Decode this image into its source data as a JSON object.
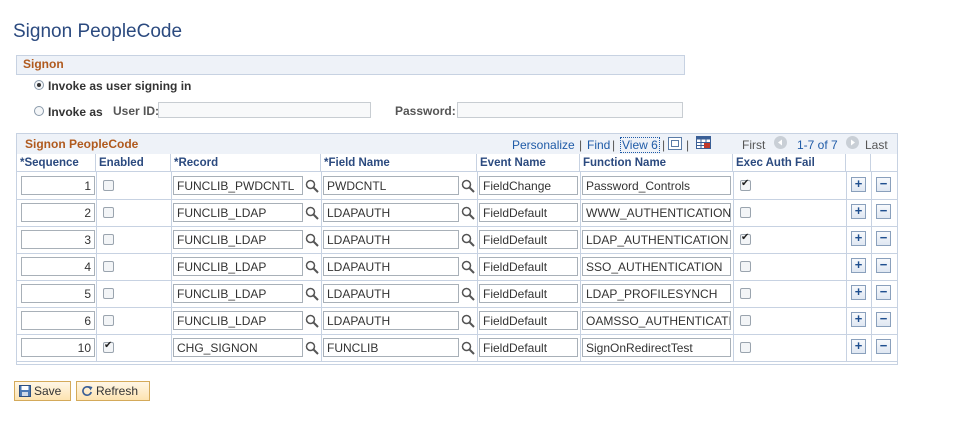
{
  "page_title": "Signon PeopleCode",
  "signon": {
    "section_title": "Signon",
    "option_invoke_signing_in": "Invoke as user signing in",
    "option_invoke_as": "Invoke as",
    "user_id_label": "User ID:",
    "user_id_value": "",
    "password_label": "Password:",
    "password_value": ""
  },
  "grid": {
    "title": "Signon PeopleCode",
    "personalize": "Personalize",
    "find": "Find",
    "view": "View 6",
    "sep": "|",
    "first": "First",
    "range": "1-7 of 7",
    "last": "Last",
    "columns": [
      "*Sequence",
      "Enabled",
      "*Record",
      "*Field Name",
      "Event Name",
      "Function Name",
      "Exec Auth Fail"
    ],
    "rows": [
      {
        "sequence": "1",
        "enabled": false,
        "record": "FUNCLIB_PWDCNTL",
        "field": "PWDCNTL",
        "event": "FieldChange",
        "function": "Password_Controls",
        "exec_auth_fail": true
      },
      {
        "sequence": "2",
        "enabled": false,
        "record": "FUNCLIB_LDAP",
        "field": "LDAPAUTH",
        "event": "FieldDefault",
        "function": "WWW_AUTHENTICATION",
        "exec_auth_fail": false
      },
      {
        "sequence": "3",
        "enabled": false,
        "record": "FUNCLIB_LDAP",
        "field": "LDAPAUTH",
        "event": "FieldDefault",
        "function": "LDAP_AUTHENTICATION",
        "exec_auth_fail": true
      },
      {
        "sequence": "4",
        "enabled": false,
        "record": "FUNCLIB_LDAP",
        "field": "LDAPAUTH",
        "event": "FieldDefault",
        "function": "SSO_AUTHENTICATION",
        "exec_auth_fail": false
      },
      {
        "sequence": "5",
        "enabled": false,
        "record": "FUNCLIB_LDAP",
        "field": "LDAPAUTH",
        "event": "FieldDefault",
        "function": "LDAP_PROFILESYNCH",
        "exec_auth_fail": false
      },
      {
        "sequence": "6",
        "enabled": false,
        "record": "FUNCLIB_LDAP",
        "field": "LDAPAUTH",
        "event": "FieldDefault",
        "function": "OAMSSO_AUTHENTICATIOI",
        "exec_auth_fail": false
      },
      {
        "sequence": "10",
        "enabled": true,
        "record": "CHG_SIGNON",
        "field": "FUNCLIB",
        "event": "FieldDefault",
        "function": "SignOnRedirectTest",
        "exec_auth_fail": false
      }
    ]
  },
  "buttons": {
    "save": "Save",
    "refresh": "Refresh"
  },
  "colors": {
    "title_blue": "#2b4a7f",
    "section_orange": "#b05a1e",
    "link_blue": "#1f5ba7"
  }
}
